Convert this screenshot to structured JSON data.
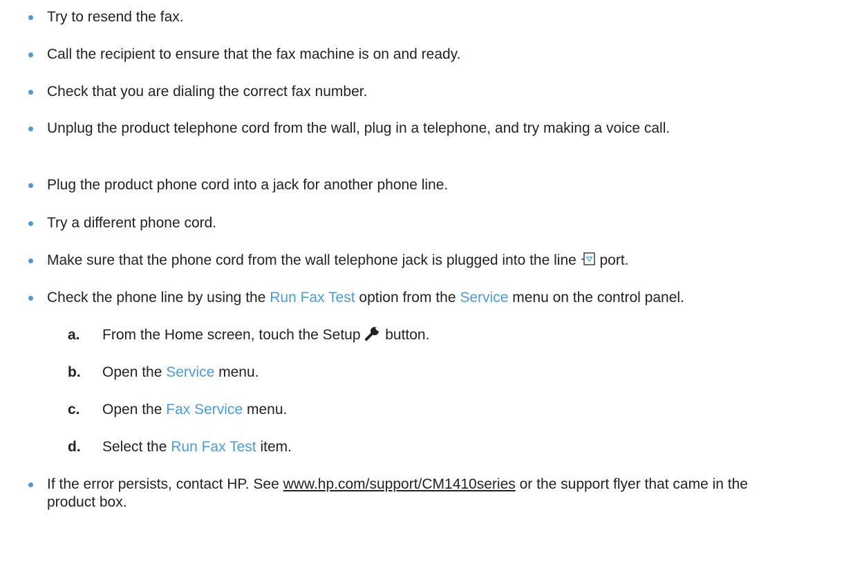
{
  "colors": {
    "accent": "#4d9bd6",
    "text": "#222222",
    "bullet": "#4d9bd6"
  },
  "bullets": [
    {
      "text": "Try to resend the fax."
    },
    {
      "text": "Call the recipient to ensure that the fax machine is on and ready."
    },
    {
      "text": "Check that you are dialing the correct fax number."
    },
    {
      "text": "Unplug the product telephone cord from the wall, plug in a telephone, and try making a voice call."
    },
    {
      "text": "Plug the product phone cord into a jack for another phone line."
    },
    {
      "text": "Try a different phone cord."
    },
    {
      "text_before": "Make sure that the phone cord from the wall telephone jack is plugged into the line",
      "icon": "line-port-icon",
      "text_after": "port."
    },
    {
      "text_before": "Check the phone line by using the",
      "kw1": "Run Fax Test",
      "text_mid": "option from the",
      "kw2": "Service",
      "text_after": "menu on the control panel."
    },
    {
      "text_before": "If the error persists, contact HP. See",
      "link": "www.hp.com/support/CM1410series",
      "text_after": "or the support flyer that came in the product box."
    }
  ],
  "steps": [
    {
      "letter": "a.",
      "text_before": "From the Home screen, touch the Setup",
      "icon": "wrench-icon",
      "text_after": "button."
    },
    {
      "letter": "b.",
      "text_before": "Open the",
      "kw": "Service",
      "text_after": "menu."
    },
    {
      "letter": "c.",
      "text_before": "Open the",
      "kw": "Fax Service",
      "text_after": "menu."
    },
    {
      "letter": "d.",
      "text_before": "Select the",
      "kw": "Run Fax Test",
      "text_after": "item."
    }
  ]
}
